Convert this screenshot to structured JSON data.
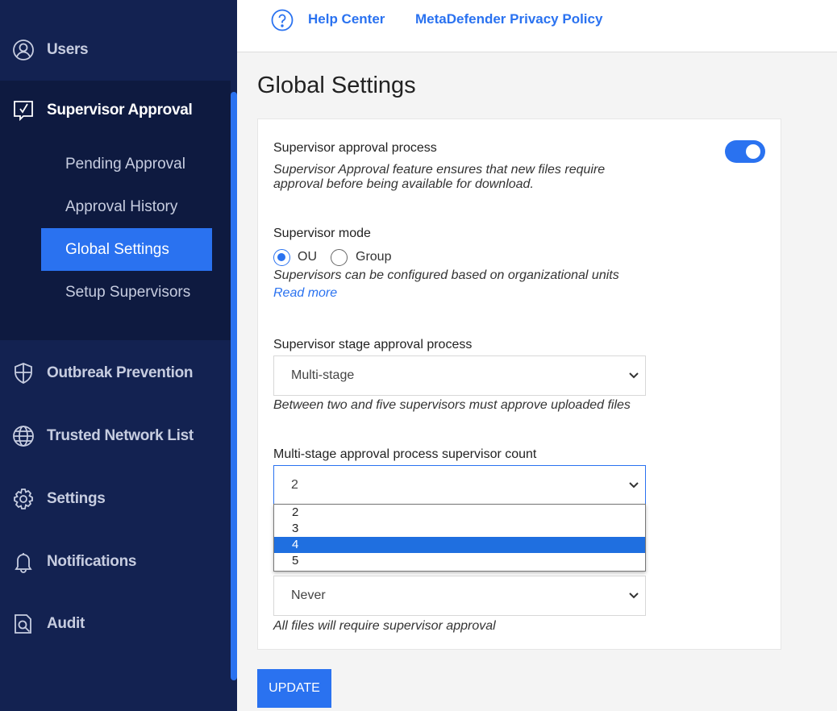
{
  "sidebar": {
    "users": "Users",
    "supervisor_approval": "Supervisor Approval",
    "sub_items": [
      "Pending Approval",
      "Approval History",
      "Global Settings",
      "Setup Supervisors"
    ],
    "outbreak_prevention": "Outbreak Prevention",
    "trusted_network_list": "Trusted Network List",
    "settings": "Settings",
    "notifications": "Notifications",
    "audit": "Audit"
  },
  "topbar": {
    "help_center": "Help Center",
    "privacy_policy": "MetaDefender Privacy Policy"
  },
  "page": {
    "title": "Global Settings"
  },
  "approval_process": {
    "label": "Supervisor approval process",
    "description": "Supervisor Approval feature ensures that new files require approval before being available for download.",
    "enabled": true
  },
  "supervisor_mode": {
    "label": "Supervisor mode",
    "options": [
      "OU",
      "Group"
    ],
    "selected": "OU",
    "description": "Supervisors can be configured based on organizational units",
    "read_more": "Read more"
  },
  "stage_process": {
    "label": "Supervisor stage approval process",
    "value": "Multi-stage",
    "description": "Between two and five supervisors must approve uploaded files"
  },
  "supervisor_count": {
    "label": "Multi-stage approval process supervisor count",
    "value": "2",
    "options": [
      "2",
      "3",
      "4",
      "5"
    ],
    "highlighted": "4"
  },
  "expiry": {
    "value": "Never",
    "description": "All files will require supervisor approval"
  },
  "actions": {
    "update": "UPDATE"
  },
  "colors": {
    "accent": "#2a72f0",
    "sidebar_bg": "#132251",
    "sidebar_sub_bg": "#0e1a40"
  }
}
